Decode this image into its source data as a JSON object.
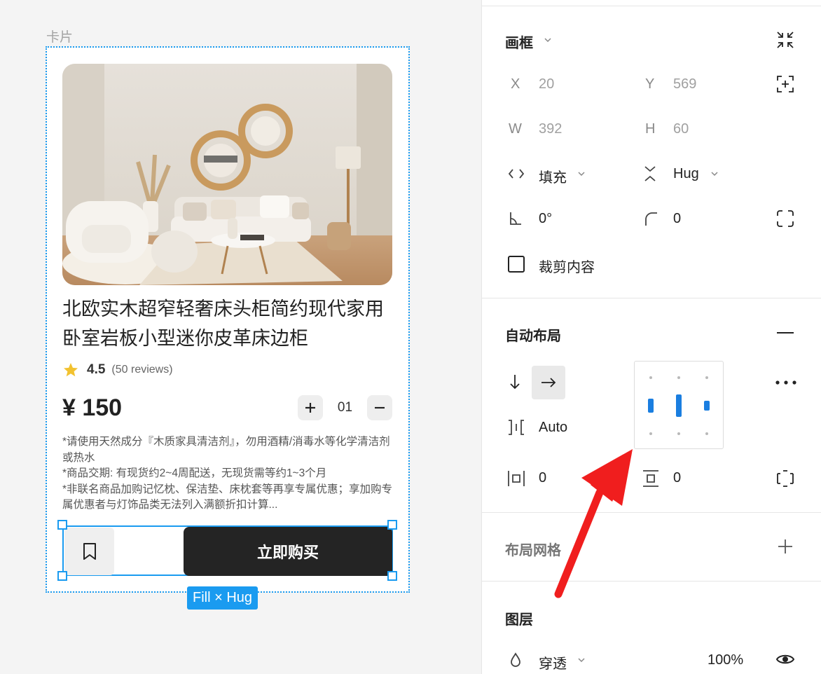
{
  "canvas": {
    "frame_label": "卡片",
    "size_badge": "Fill × Hug"
  },
  "card": {
    "title": "北欧实木超窄轻奢床头柜简约现代家用卧室岩板小型迷你皮革床边柜",
    "rating": {
      "value": "4.5",
      "count": "(50 reviews)",
      "icon": "star-icon"
    },
    "price": "¥ 150",
    "quantity": {
      "value": "01",
      "plus": "+",
      "minus": "−"
    },
    "notes": [
      "*请使用天然成分『木质家具清洁剂』，勿用酒精/消毒水等化学清洁剂或热水",
      "*商品交期: 有现货约2~4周配送，无现货需等约1~3个月",
      "*非联名商品加购记忆枕、保洁垫、床枕套等再享专属优惠；享加购专属优惠者与灯饰品类无法列入满额折扣计算..."
    ],
    "buy_label": "立即购买",
    "bookmark_icon": "bookmark-icon"
  },
  "panel": {
    "frame": {
      "title": "画框",
      "x_label": "X",
      "x_value": "20",
      "y_label": "Y",
      "y_value": "569",
      "w_label": "W",
      "w_value": "392",
      "h_label": "H",
      "h_value": "60",
      "width_mode": "填充",
      "height_mode": "Hug",
      "rotation": "0°",
      "radius": "0",
      "clip_label": "裁剪内容"
    },
    "auto_layout": {
      "title": "自动布局",
      "spacing": "Auto",
      "padding_h": "0",
      "padding_v": "0"
    },
    "layout_grid": {
      "title": "布局网格"
    },
    "layers": {
      "title": "图层",
      "blend_mode": "穿透",
      "opacity": "100%"
    }
  },
  "colors": {
    "selection": "#1a9bf0",
    "buy_button": "#242424",
    "star": "#f2c230",
    "annotation_arrow": "#f01e1e",
    "alignment_active": "#1a7ee0"
  }
}
